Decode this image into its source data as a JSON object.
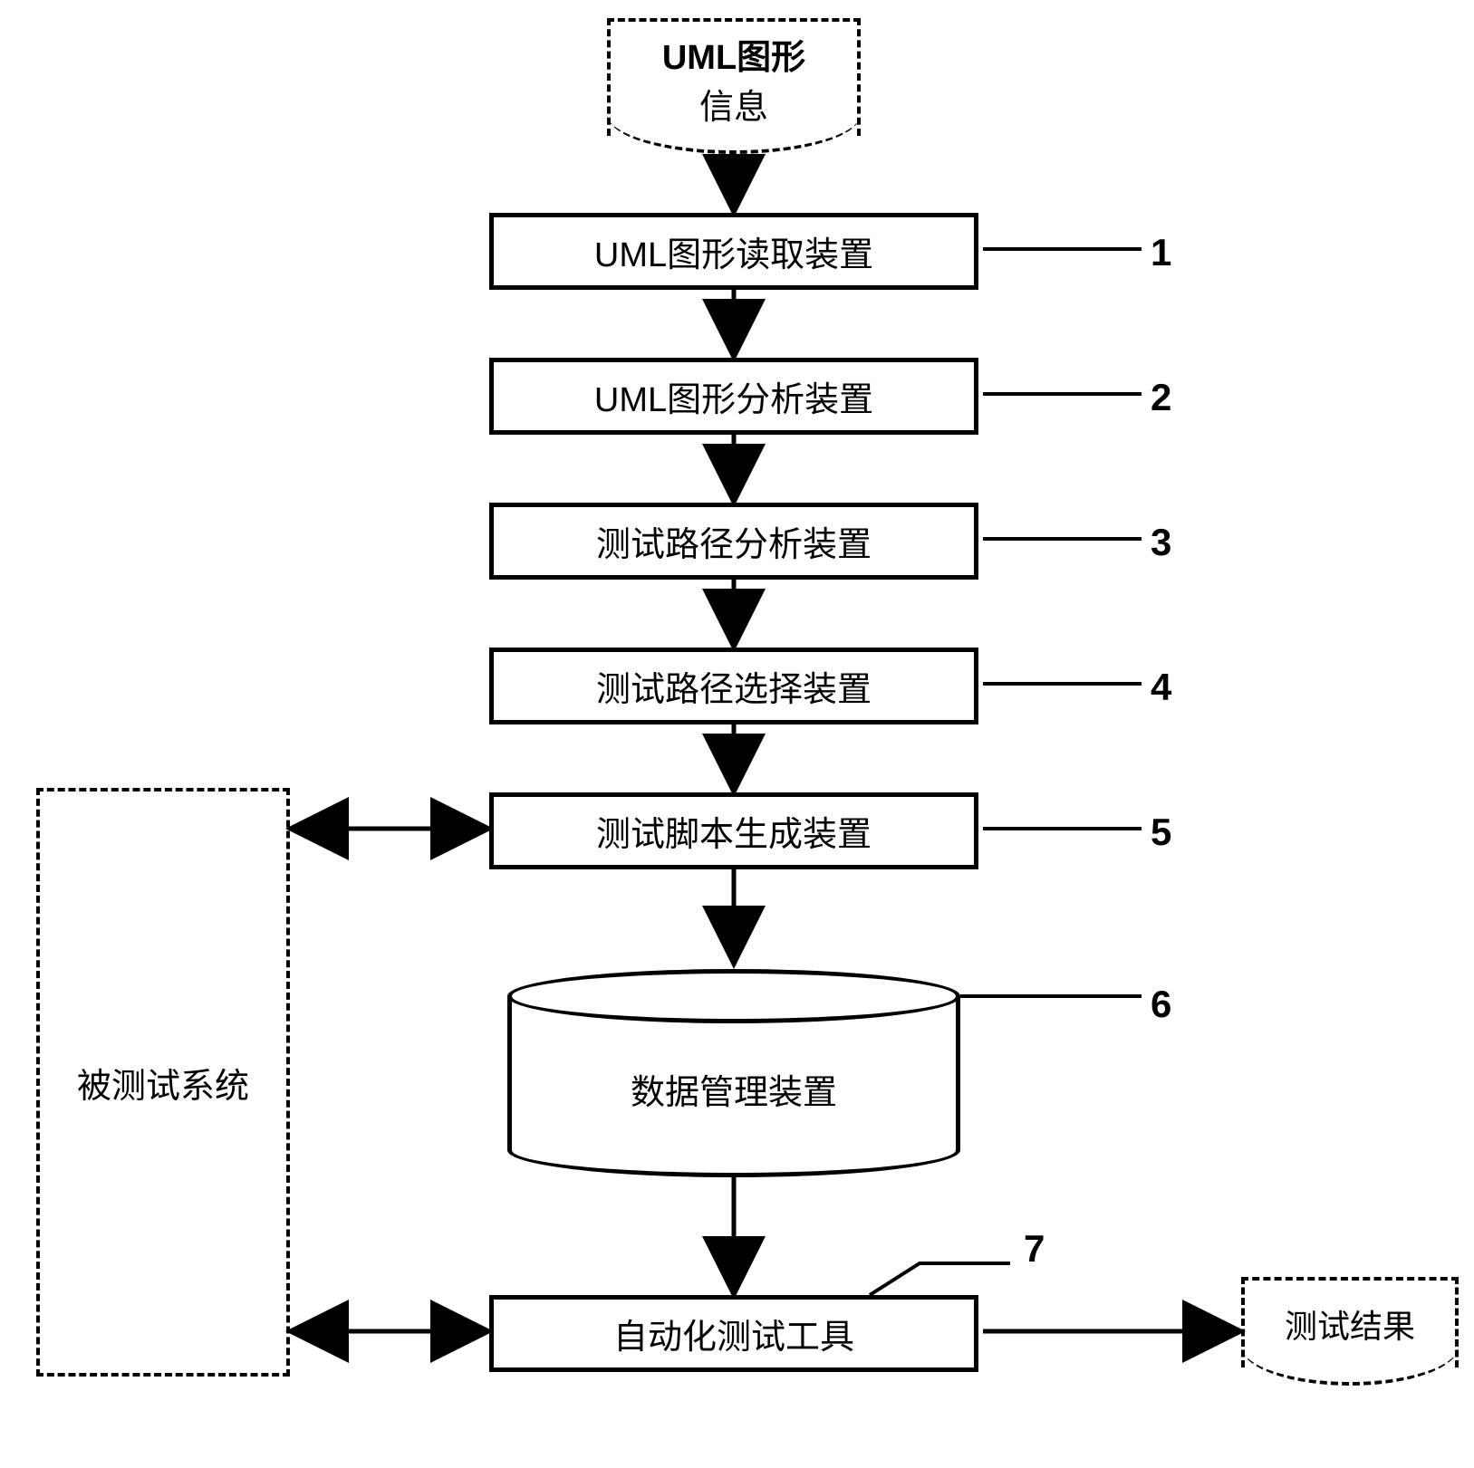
{
  "input_doc": {
    "line1": "UML图形",
    "line2": "信息"
  },
  "boxes": {
    "box1": "UML图形读取装置",
    "box2": "UML图形分析装置",
    "box3": "测试路径分析装置",
    "box4": "测试路径选择装置",
    "box5": "测试脚本生成装置",
    "cylinder": "数据管理装置",
    "box7": "自动化测试工具"
  },
  "side_system": "被测试系统",
  "output_doc": "测试结果",
  "numbers": {
    "n1": "1",
    "n2": "2",
    "n3": "3",
    "n4": "4",
    "n5": "5",
    "n6": "6",
    "n7": "7"
  }
}
